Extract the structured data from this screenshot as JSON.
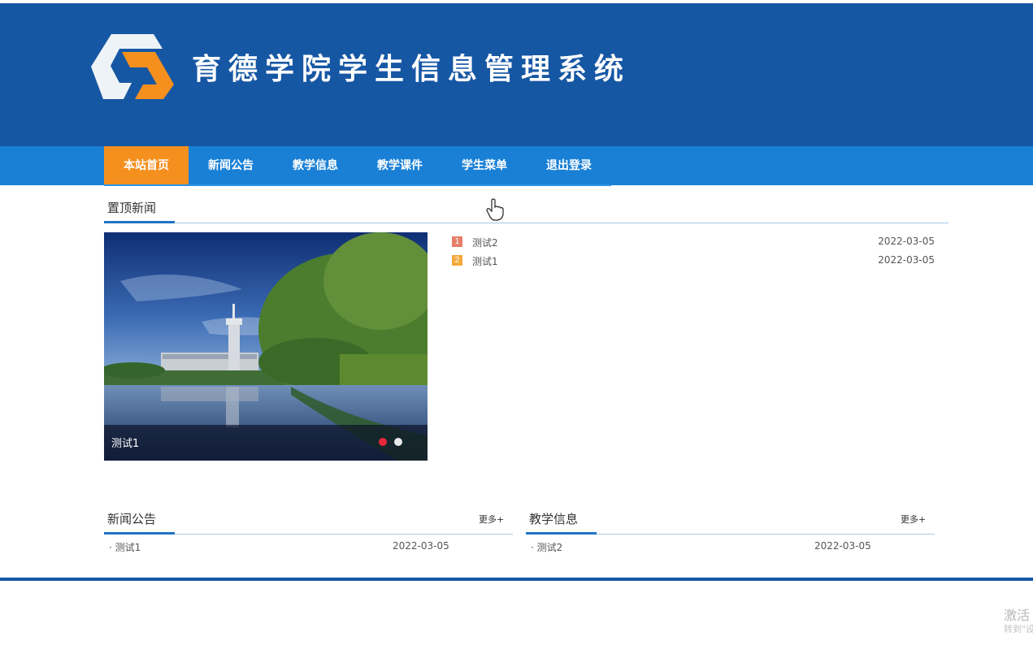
{
  "header": {
    "title": "育德学院学生信息管理系统",
    "logo_icon": "school-logo"
  },
  "nav": {
    "items": [
      {
        "label": "本站首页",
        "active": true
      },
      {
        "label": "新闻公告",
        "active": false
      },
      {
        "label": "教学信息",
        "active": false
      },
      {
        "label": "教学课件",
        "active": false
      },
      {
        "label": "学生菜单",
        "active": false
      },
      {
        "label": "退出登录",
        "active": false
      }
    ]
  },
  "top_news": {
    "title": "置顶新闻",
    "slider": {
      "caption": "测试1",
      "active_dot": 1,
      "dot_count": 2
    },
    "items": [
      {
        "rank": "1",
        "title": "测试2",
        "date": "2022-03-05"
      },
      {
        "rank": "2",
        "title": "测试1",
        "date": "2022-03-05"
      }
    ]
  },
  "news_notice": {
    "title": "新闻公告",
    "more": "更多+",
    "items": [
      {
        "title": "· 测试1",
        "date": "2022-03-05"
      }
    ]
  },
  "teaching_info": {
    "title": "教学信息",
    "more": "更多+",
    "items": [
      {
        "title": "· 测试2",
        "date": "2022-03-05"
      }
    ]
  },
  "watermark": {
    "line1": "激活",
    "line2": "转到\"设"
  },
  "colors": {
    "header": "#1657a4",
    "nav": "#1980d6",
    "nav_active": "#f5901e"
  }
}
